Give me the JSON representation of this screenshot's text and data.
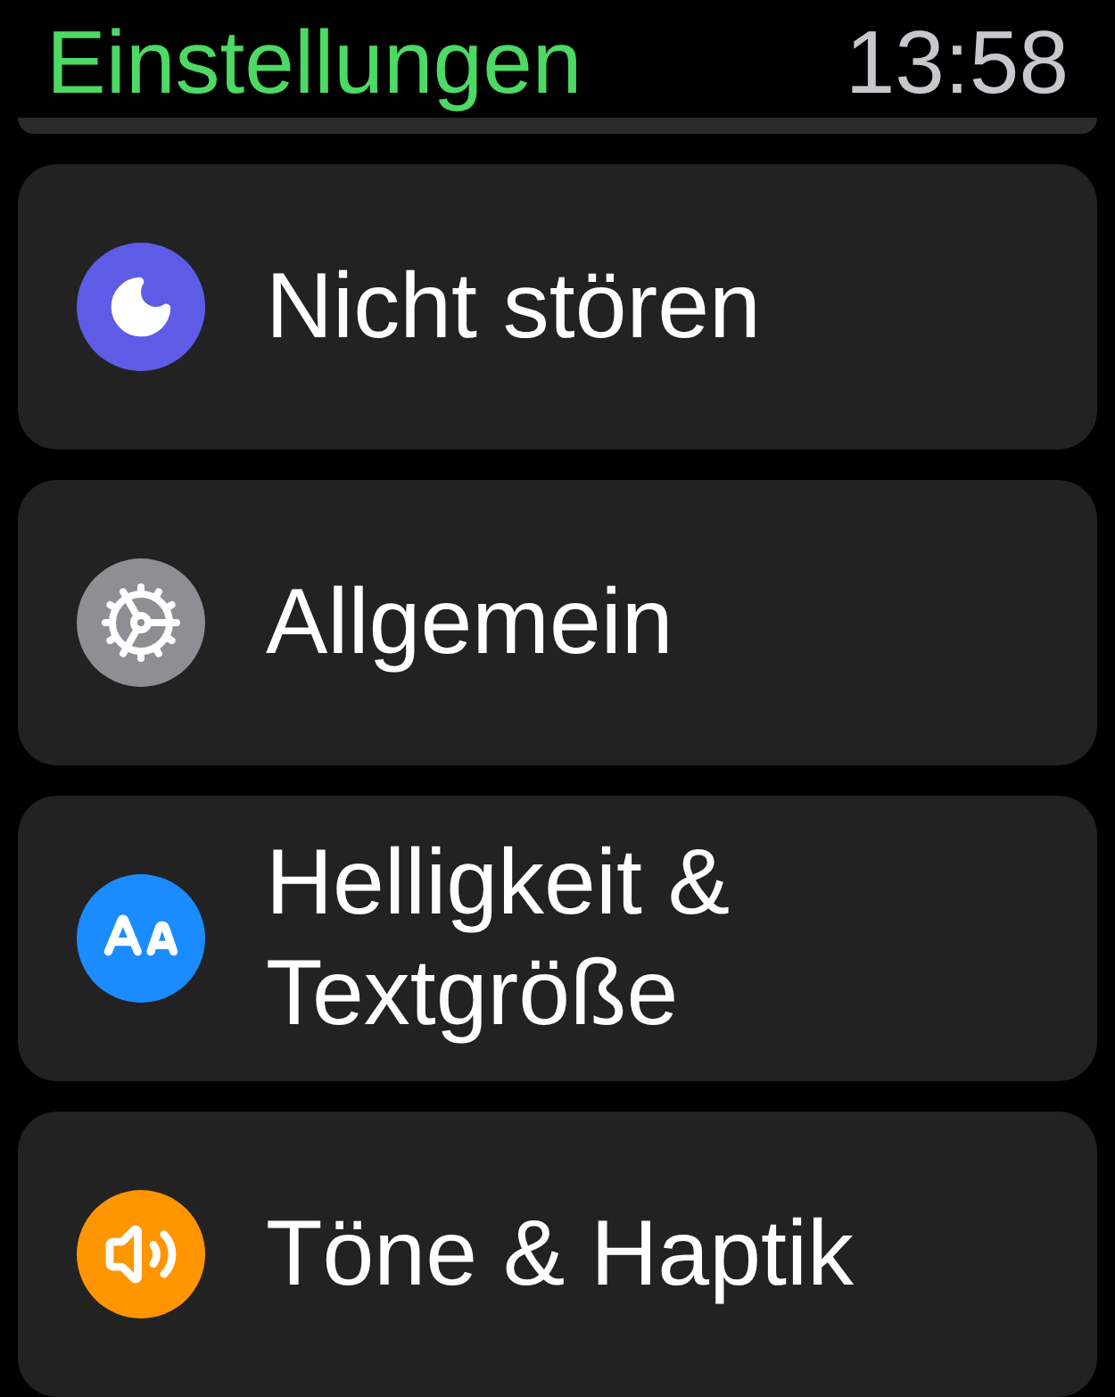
{
  "header": {
    "title": "Einstellungen",
    "time": "13:58"
  },
  "items": [
    {
      "label": "Nicht stören"
    },
    {
      "label": "Allgemein"
    },
    {
      "label": "Helligkeit & Textgröße"
    },
    {
      "label": "Töne & Haptik"
    }
  ]
}
